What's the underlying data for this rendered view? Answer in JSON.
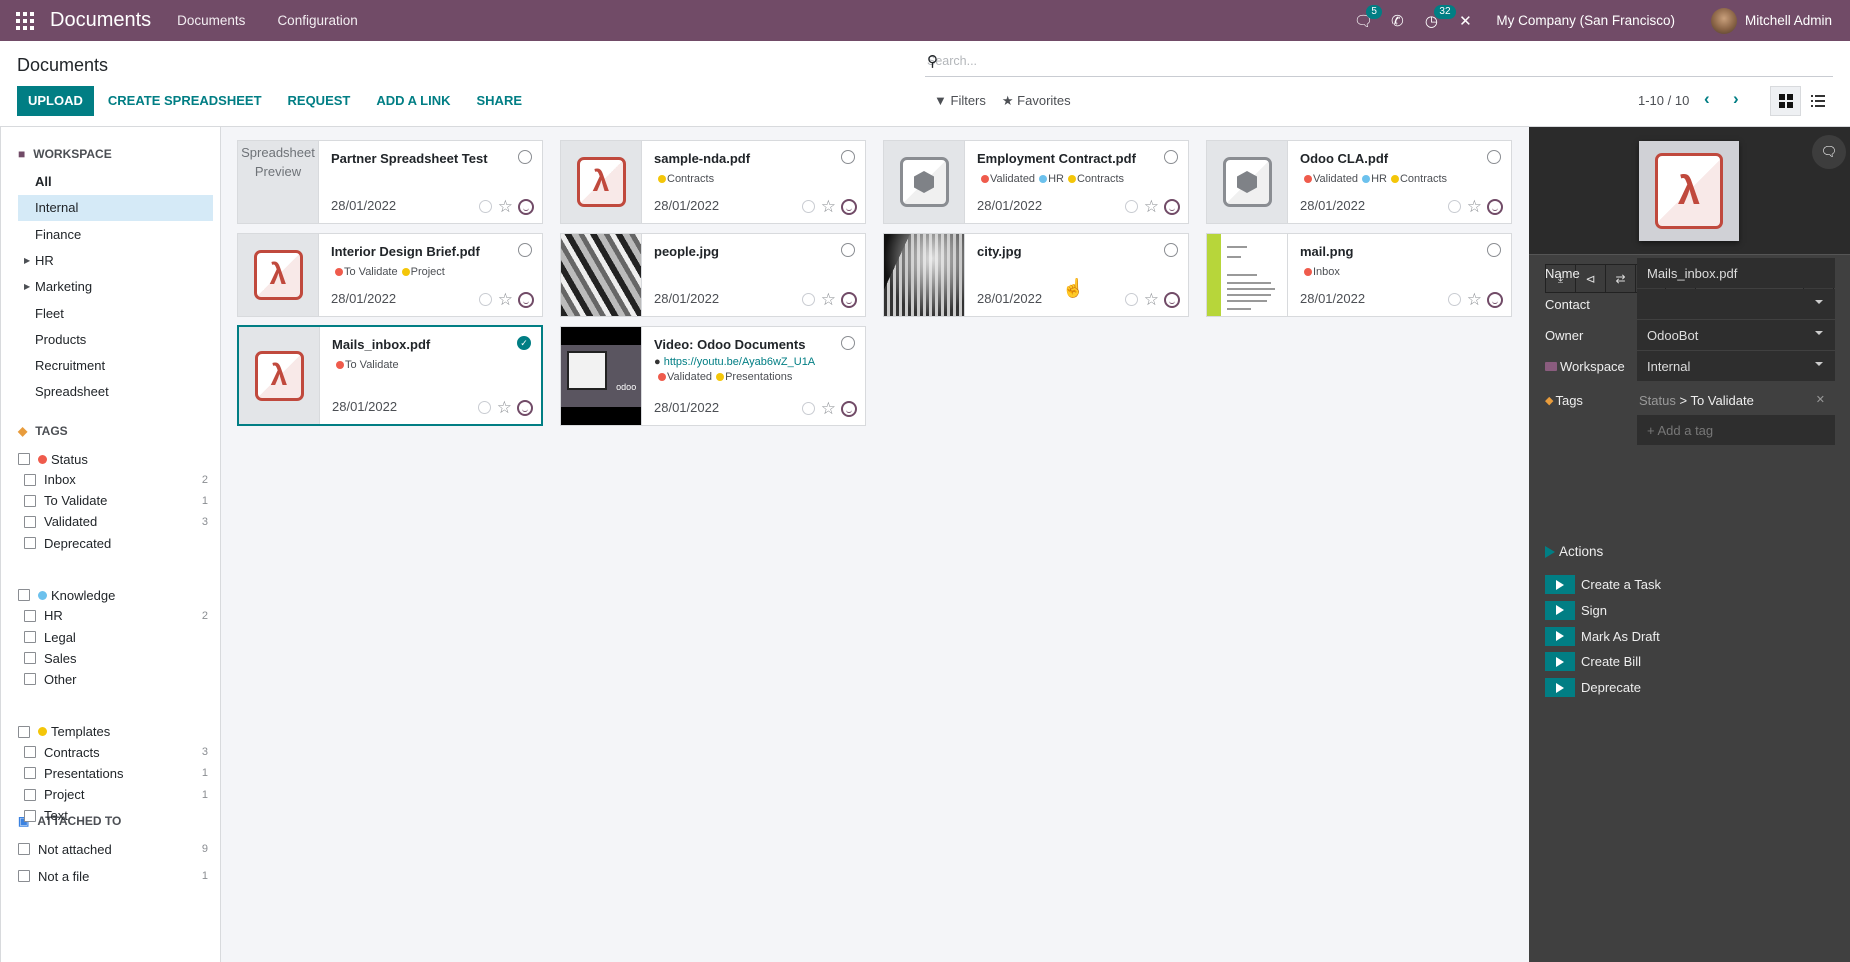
{
  "navbar": {
    "app_name": "Documents",
    "menu": [
      "Documents",
      "Configuration"
    ],
    "messages_badge": "5",
    "activities_badge": "32",
    "company": "My Company (San Francisco)",
    "user": "Mitchell Admin"
  },
  "control_panel": {
    "title": "Documents",
    "buttons": {
      "upload": "UPLOAD",
      "create_spreadsheet": "CREATE SPREADSHEET",
      "request": "REQUEST",
      "add_link": "ADD A LINK",
      "share": "SHARE"
    },
    "search_placeholder": "Search...",
    "filters": "Filters",
    "favorites": "Favorites",
    "pager": "1-10 / 10",
    "active_view": "kanban"
  },
  "sidebar": {
    "workspace_title": "WORKSPACE",
    "workspaces": [
      {
        "label": "All",
        "bold": true
      },
      {
        "label": "Internal",
        "active": true
      },
      {
        "label": "Finance"
      },
      {
        "label": "HR",
        "expandable": true
      },
      {
        "label": "Marketing",
        "expandable": true
      },
      {
        "label": "Fleet"
      },
      {
        "label": "Products"
      },
      {
        "label": "Recruitment"
      },
      {
        "label": "Spreadsheet"
      }
    ],
    "tags_title": "TAGS",
    "tag_groups": [
      {
        "label": "Status",
        "color": "#ef5b4c",
        "tags": [
          {
            "label": "Inbox",
            "count": "2"
          },
          {
            "label": "To Validate",
            "count": "1"
          },
          {
            "label": "Validated",
            "count": "3"
          },
          {
            "label": "Deprecated",
            "count": ""
          }
        ]
      },
      {
        "label": "Knowledge",
        "color": "#6cc1ed",
        "tags": [
          {
            "label": "HR",
            "count": "2"
          },
          {
            "label": "Legal",
            "count": ""
          },
          {
            "label": "Sales",
            "count": ""
          },
          {
            "label": "Other",
            "count": ""
          }
        ]
      },
      {
        "label": "Templates",
        "color": "#f4c609",
        "tags": [
          {
            "label": "Contracts",
            "count": "3"
          },
          {
            "label": "Presentations",
            "count": "1"
          },
          {
            "label": "Project",
            "count": "1"
          },
          {
            "label": "Text",
            "count": ""
          }
        ]
      }
    ],
    "attached_title": "ATTACHED TO",
    "attached": [
      {
        "label": "Not attached",
        "count": "9"
      },
      {
        "label": "Not a file",
        "count": "1"
      }
    ]
  },
  "tag_colors": {
    "red": "#ef5b4c",
    "blue": "#6cc1ed",
    "yellow": "#f4c609"
  },
  "documents": [
    {
      "name": "Partner Spreadsheet Test",
      "thumb": "spreadsheet",
      "thumb_text": [
        "Spreadsheet",
        "Preview"
      ],
      "tags": [],
      "date": "28/01/2022",
      "selected": false
    },
    {
      "name": "sample-nda.pdf",
      "thumb": "pdf",
      "tags": [
        {
          "label": "Contracts",
          "color": "yellow"
        }
      ],
      "date": "28/01/2022",
      "selected": false
    },
    {
      "name": "Employment Contract.pdf",
      "thumb": "box",
      "tags": [
        {
          "label": "Validated",
          "color": "red"
        },
        {
          "label": "HR",
          "color": "blue"
        },
        {
          "label": "Contracts",
          "color": "yellow"
        }
      ],
      "date": "28/01/2022",
      "selected": false
    },
    {
      "name": "Odoo CLA.pdf",
      "thumb": "box",
      "tags": [
        {
          "label": "Validated",
          "color": "red"
        },
        {
          "label": "HR",
          "color": "blue"
        },
        {
          "label": "Contracts",
          "color": "yellow"
        }
      ],
      "date": "28/01/2022",
      "selected": false
    },
    {
      "name": "Interior Design Brief.pdf",
      "thumb": "pdf",
      "tags": [
        {
          "label": "To Validate",
          "color": "red"
        },
        {
          "label": "Project",
          "color": "yellow"
        }
      ],
      "date": "28/01/2022",
      "selected": false
    },
    {
      "name": "people.jpg",
      "thumb": "people",
      "tags": [],
      "date": "28/01/2022",
      "selected": false
    },
    {
      "name": "city.jpg",
      "thumb": "city",
      "tags": [],
      "date": "28/01/2022",
      "selected": false
    },
    {
      "name": "mail.png",
      "thumb": "mail",
      "tags": [
        {
          "label": "Inbox",
          "color": "red"
        }
      ],
      "date": "28/01/2022",
      "selected": false
    },
    {
      "name": "Mails_inbox.pdf",
      "thumb": "pdf",
      "tags": [
        {
          "label": "To Validate",
          "color": "red"
        }
      ],
      "date": "28/01/2022",
      "selected": true
    },
    {
      "name": "Video: Odoo Documents",
      "thumb": "video",
      "url": "https://youtu.be/Ayab6wZ_U1A",
      "tags": [
        {
          "label": "Validated",
          "color": "red"
        },
        {
          "label": "Presentations",
          "color": "yellow"
        }
      ],
      "date": "28/01/2022",
      "selected": false
    }
  ],
  "inspector": {
    "fields": {
      "name_label": "Name",
      "name_value": "Mails_inbox.pdf",
      "contact_label": "Contact",
      "contact_value": "",
      "owner_label": "Owner",
      "owner_value": "OdooBot",
      "workspace_label": "Workspace",
      "workspace_value": "Internal",
      "tags_label": "Tags",
      "tag_group": "Status",
      "tag_sep": " > ",
      "tag_value": "To Validate",
      "add_tag_placeholder": "+ Add a tag"
    },
    "actions_title": "Actions",
    "actions": [
      "Create a Task",
      "Sign",
      "Mark As Draft",
      "Create Bill",
      "Deprecate"
    ]
  }
}
